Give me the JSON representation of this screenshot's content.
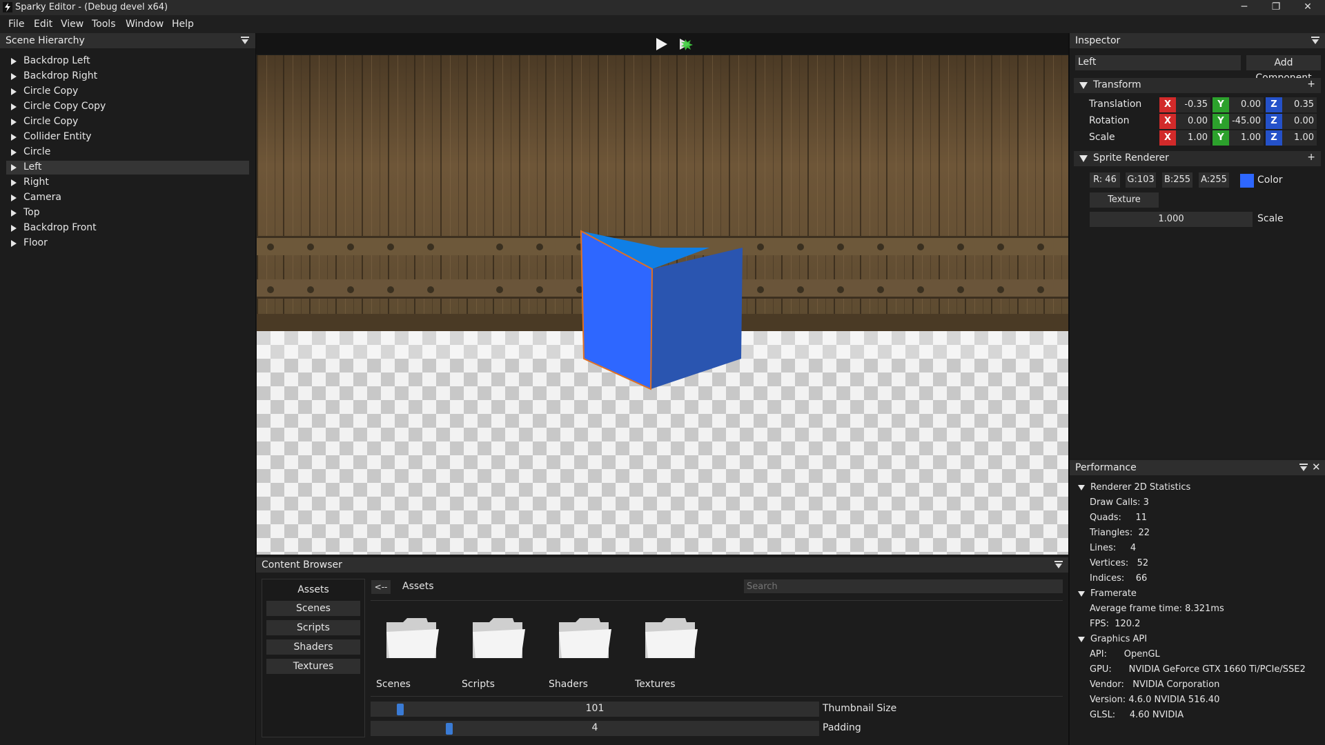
{
  "window": {
    "title": "Sparky Editor - (Debug devel x64)",
    "controls": {
      "minimize": "─",
      "restore": "❐",
      "close": "✕"
    }
  },
  "menu": [
    "File",
    "Edit",
    "View",
    "Tools",
    "Window",
    "Help"
  ],
  "hierarchy": {
    "title": "Scene Hierarchy",
    "items": [
      "Backdrop Left",
      "Backdrop Right",
      "Circle Copy",
      "Circle Copy Copy",
      "Circle Copy",
      "Collider Entity",
      "Circle",
      "Left",
      "Right",
      "Camera",
      "Top",
      "Backdrop Front",
      "Floor"
    ],
    "selected": "Left"
  },
  "toolbar": {
    "play_icon": "play-icon",
    "simulate_icon": "simulate-icon"
  },
  "viewport": {
    "cube_color": "#2e67ff",
    "outline_color": "#e07020"
  },
  "content_browser": {
    "title": "Content Browser",
    "sidebar_title": "Assets",
    "sidebar_items": [
      "Scenes",
      "Scripts",
      "Shaders",
      "Textures"
    ],
    "back": "<--",
    "current_path": "Assets",
    "search_placeholder": "Search",
    "folders": [
      "Scenes",
      "Scripts",
      "Shaders",
      "Textures"
    ],
    "thumbnail_size": {
      "value": "101",
      "label": "Thumbnail Size",
      "fraction": 0.06
    },
    "padding": {
      "value": "4",
      "label": "Padding",
      "fraction": 0.17
    }
  },
  "inspector": {
    "title": "Inspector",
    "entity_name": "Left",
    "add_component": "Add Component",
    "transform": {
      "title": "Transform",
      "plus": "+",
      "rows": [
        {
          "label": "Translation",
          "x": "-0.35",
          "y": "0.00",
          "z": "0.35"
        },
        {
          "label": "Rotation",
          "x": "0.00",
          "y": "-45.00",
          "z": "0.00"
        },
        {
          "label": "Scale",
          "x": "1.00",
          "y": "1.00",
          "z": "1.00"
        }
      ],
      "axis_x": "X",
      "axis_y": "Y",
      "axis_z": "Z"
    },
    "sprite_renderer": {
      "title": "Sprite Renderer",
      "plus": "+",
      "r": "R: 46",
      "g": "G:103",
      "b": "B:255",
      "a": "A:255",
      "color_label": "Color",
      "color_swatch": "#2e67ff",
      "texture": "Texture",
      "scale_value": "1.000",
      "scale_label": "Scale"
    }
  },
  "performance": {
    "title": "Performance",
    "renderer": {
      "title": "Renderer 2D Statistics",
      "lines": [
        "Draw Calls: 3",
        "Quads:     11",
        "Triangles:  22",
        "Lines:     4",
        "Vertices:   52",
        "Indices:    66"
      ]
    },
    "framerate": {
      "title": "Framerate",
      "lines": [
        "Average frame time: 8.321ms",
        "FPS:  120.2"
      ]
    },
    "graphics": {
      "title": "Graphics API",
      "lines": [
        "API:      OpenGL",
        "GPU:      NVIDIA GeForce GTX 1660 Ti/PCIe/SSE2",
        "Vendor:   NVIDIA Corporation",
        "Version: 4.6.0 NVIDIA 516.40",
        "GLSL:     4.60 NVIDIA"
      ]
    }
  }
}
